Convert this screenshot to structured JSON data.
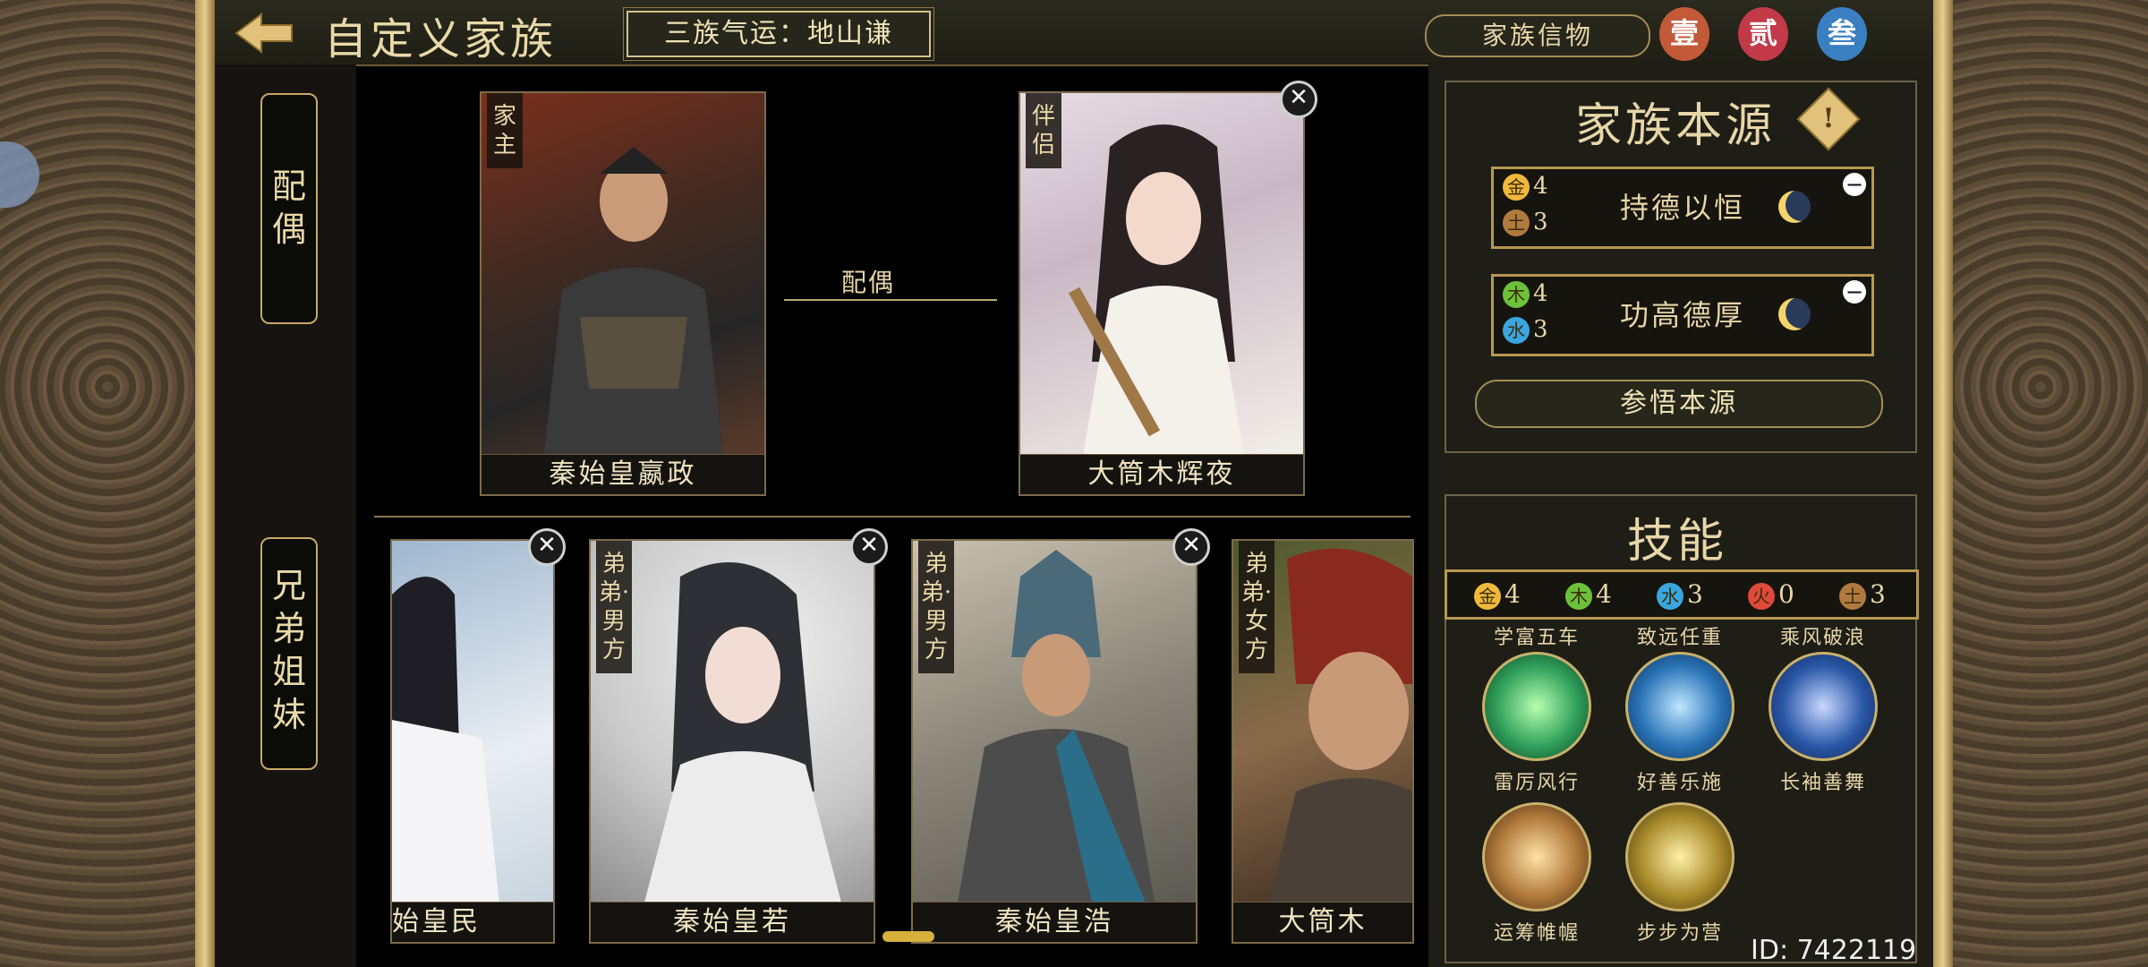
{
  "header": {
    "title": "自定义家族",
    "fortune": "三族气运：地山谦",
    "relic_button": "家族信物",
    "medals": [
      {
        "label": "壹",
        "color": "#c25a3a"
      },
      {
        "label": "贰",
        "color": "#c23a48"
      },
      {
        "label": "叁",
        "color": "#3a7fc2"
      }
    ]
  },
  "tabs": {
    "spouse": "配偶",
    "siblings": "兄弟姐妹"
  },
  "spouse_section": {
    "relation_label": "配偶",
    "head": {
      "role": "家主",
      "name": "秦始皇嬴政"
    },
    "partner": {
      "role": "伴侣",
      "name": "大筒木辉夜"
    }
  },
  "siblings": [
    {
      "role": "",
      "name": "始皇民"
    },
    {
      "role": "弟弟·男方",
      "name": "秦始皇若"
    },
    {
      "role": "弟弟·男方",
      "name": "秦始皇浩"
    },
    {
      "role": "弟弟·女方",
      "name": "大筒木"
    }
  ],
  "family_source": {
    "title": "家族本源",
    "rows": [
      {
        "elements": [
          {
            "symbol": "金",
            "count": "4",
            "color": "#f0b83a"
          },
          {
            "symbol": "土",
            "count": "3",
            "color": "#b07a3f"
          }
        ],
        "name": "持德以恒"
      },
      {
        "elements": [
          {
            "symbol": "木",
            "count": "4",
            "color": "#6bc23a"
          },
          {
            "symbol": "水",
            "count": "3",
            "color": "#3aa6e0"
          }
        ],
        "name": "功高德厚"
      }
    ],
    "comprehend_button": "参悟本源"
  },
  "skills": {
    "title": "技能",
    "elements": [
      {
        "symbol": "金",
        "count": "4",
        "color": "#f0b83a"
      },
      {
        "symbol": "木",
        "count": "4",
        "color": "#6bc23a"
      },
      {
        "symbol": "水",
        "count": "3",
        "color": "#3aa6e0"
      },
      {
        "symbol": "火",
        "count": "0",
        "color": "#e04a3a"
      },
      {
        "symbol": "土",
        "count": "3",
        "color": "#b07a3f"
      }
    ],
    "top_labels": [
      "学富五车",
      "致远任重",
      "乘风破浪"
    ],
    "row1": [
      {
        "name": "雷厉风行",
        "color": "#2fa05a"
      },
      {
        "name": "好善乐施",
        "color": "#2a74b8"
      },
      {
        "name": "长袖善舞",
        "color": "#2a58a8"
      }
    ],
    "row2": [
      {
        "name": "运筹帷幄",
        "color": "#b0793a"
      },
      {
        "name": "步步为营",
        "color": "#a88a2a"
      }
    ]
  },
  "player_id": "ID: 7422119"
}
